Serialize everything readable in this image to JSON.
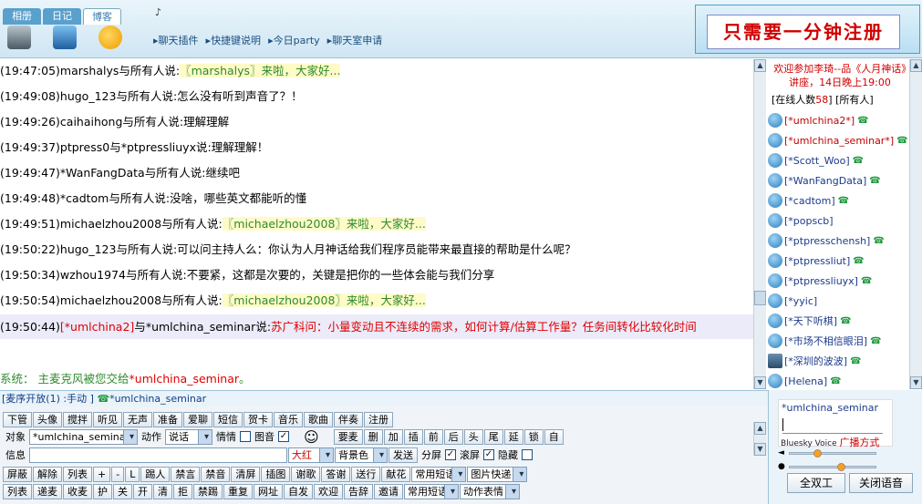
{
  "tabs": [
    "相册",
    "日记",
    "博客"
  ],
  "speaker_icon": "♪",
  "toolbar_links": [
    "聊天插件",
    "快捷键说明",
    "今日party",
    "聊天室申请"
  ],
  "banner": {
    "text": "只需要一分钟注册"
  },
  "messages": [
    {
      "time": "(19:47:05)",
      "from": "marshalys",
      "mid": "与所有人说:",
      "text": "〖marshalys〗来啦，大家好...",
      "style": "hl"
    },
    {
      "time": "(19:49:08)",
      "from": "hugo_123",
      "mid": "与所有人说:",
      "text": "怎么没有听到声音了？！",
      "style": ""
    },
    {
      "time": "(19:49:26)",
      "from": "caihaihong",
      "mid": "与所有人说:",
      "text": "理解理解",
      "style": ""
    },
    {
      "time": "(19:49:37)",
      "from": "ptpress0",
      "mid": "与*ptpressliuyx说:",
      "text": "理解理解！",
      "style": ""
    },
    {
      "time": "(19:49:47)",
      "from": "*WanFangData",
      "mid": "与所有人说:",
      "text": "继续吧",
      "style": ""
    },
    {
      "time": "(19:49:48)",
      "from": "*cadtom",
      "mid": "与所有人说:",
      "text": "没啥，哪些英文都能听的懂",
      "style": ""
    },
    {
      "time": "(19:49:51)",
      "from": "michaelzhou2008",
      "mid": "与所有人说:",
      "text": "〖michaelzhou2008〗来啦，大家好...",
      "style": "hl"
    },
    {
      "time": "(19:50:22)",
      "from": "hugo_123",
      "mid": "与所有人说:",
      "text": "可以问主持人么：你认为人月神话给我们程序员能带来最直接的帮助是什么呢？",
      "style": ""
    },
    {
      "time": "(19:50:34)",
      "from": "wzhou1974",
      "mid": "与所有人说:",
      "text": "不要紧，这都是次要的，关键是把你的一些体会能与我们分享",
      "style": ""
    },
    {
      "time": "(19:50:54)",
      "from": "michaelzhou2008",
      "mid": "与所有人说:",
      "text": "〖michaelzhou2008〗来啦，大家好...",
      "style": "hl"
    }
  ],
  "highlight_message": {
    "time": "(19:50:44)",
    "from": "[*umlchina2]",
    "mid": "与",
    "to": "*umlchina_seminar",
    "said": "说:",
    "text": "苏广科问：小量变动且不连续的需求，如何计算/估算工作量？任务间转化比较化时间"
  },
  "system_message": {
    "label": "系统：",
    "text": "主麦克风被您交给",
    "target": "*umlchina_seminar",
    "end": "。"
  },
  "notice": "欢迎参加李琦--品《人月神话》讲座，14日晚上19:00",
  "online": {
    "prefix": "[在线人数",
    "count": "58",
    "suffix": "] [所有人]"
  },
  "users": [
    {
      "name": "[*umlchina2*]",
      "red": true,
      "phone": true
    },
    {
      "name": "[*umlchina_seminar*]",
      "red": true,
      "phone": true
    },
    {
      "name": "[*Scott_Woo]",
      "red": false,
      "phone": true
    },
    {
      "name": "[*WanFangData]",
      "red": false,
      "phone": true
    },
    {
      "name": "[*cadtom]",
      "red": false,
      "phone": true
    },
    {
      "name": "[*popscb]",
      "red": false,
      "phone": false
    },
    {
      "name": "[*ptpresschensh]",
      "red": false,
      "phone": true
    },
    {
      "name": "[*ptpressliut]",
      "red": false,
      "phone": true
    },
    {
      "name": "[*ptpressliuyx]",
      "red": false,
      "phone": true
    },
    {
      "name": "[*yyic]",
      "red": false,
      "phone": false
    },
    {
      "name": "[*天下听棋]",
      "red": false,
      "phone": true
    },
    {
      "name": "[*市场不相信眼泪]",
      "red": false,
      "phone": true
    },
    {
      "name": "[*深圳的波波]",
      "red": false,
      "phone": true,
      "pic": true
    },
    {
      "name": "[Helena]",
      "red": false,
      "phone": true
    }
  ],
  "status_bar": {
    "text": "[麦序开放(1) :手动 ]",
    "user": "*umlchina_seminar"
  },
  "row1_buttons": [
    "下管",
    "头像",
    "搅拌",
    "听见",
    "无声",
    "准备",
    "爱聊",
    "短信",
    "贺卡",
    "音乐",
    "歌曲",
    "伴奏",
    "注册"
  ],
  "row2": {
    "target_label": "对象",
    "target_value": "*umlchina_semina",
    "action_label": "动作",
    "action_value": "说话",
    "mood_label": "情情",
    "icon_label": "图音",
    "smile": "☺",
    "buttons": [
      "要麦",
      "删",
      "加",
      "插",
      "前",
      "后",
      "头",
      "尾",
      "延",
      "锁",
      "自"
    ]
  },
  "row3": {
    "info_label": "信息",
    "size_value": "大红",
    "bg_value": "背景色",
    "send_label": "发送",
    "split_label": "分屏",
    "scroll_label": "滚屏",
    "hide_label": "隐藏"
  },
  "row4_buttons": [
    "屏蔽",
    "解除",
    "列表",
    "+",
    "-",
    "L",
    "踢人",
    "禁言",
    "禁音",
    "清屏",
    "插图",
    "谢歌",
    "答谢",
    "送行",
    "献花"
  ],
  "row4_selects": [
    "常用短语",
    "图片快递"
  ],
  "row5_buttons": [
    "列表",
    "递麦",
    "收麦",
    "护",
    "关",
    "开",
    "清",
    "拒",
    "禁踢",
    "重复",
    "网址",
    "自发",
    "欢迎",
    "告辞",
    "邀请"
  ],
  "row5_selects": [
    "常用短语",
    "动作表情"
  ],
  "voice": {
    "user": "*umlchina_seminar",
    "brand": "Bluesky Voice",
    "mode": "广播方式",
    "btn_full": "全双工",
    "btn_close": "关闭语音",
    "volume_level": 0.3,
    "mic_level": 0.6
  }
}
